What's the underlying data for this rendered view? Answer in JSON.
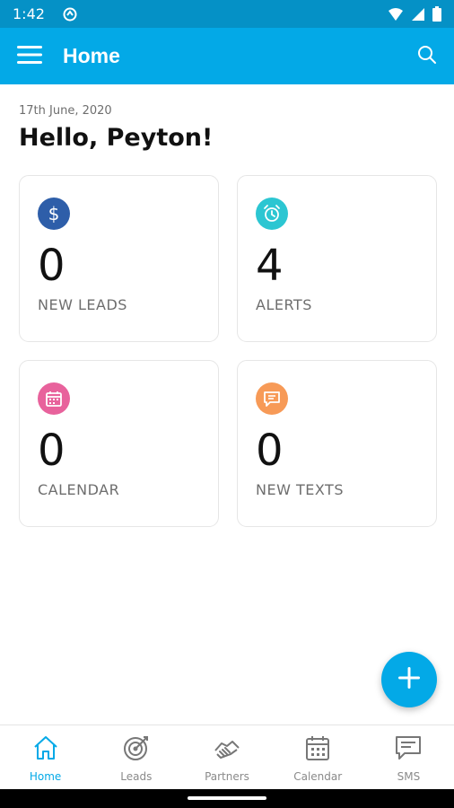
{
  "status_bar": {
    "time": "1:42",
    "bg_color": "#0591c6"
  },
  "app_bar": {
    "title": "Home",
    "bg_color": "#03a9e7",
    "icons": [
      "menu-icon",
      "search-icon"
    ]
  },
  "header": {
    "date": "17th June, 2020",
    "greeting": "Hello, Peyton!"
  },
  "cards": [
    {
      "count": "0",
      "label": "NEW LEADS",
      "icon": "dollar-icon",
      "color": "#2e5ea9"
    },
    {
      "count": "4",
      "label": "ALERTS",
      "icon": "alarm-clock-icon",
      "color": "#2cc6d2"
    },
    {
      "count": "0",
      "label": "CALENDAR",
      "icon": "calendar-icon",
      "color": "#e8629c"
    },
    {
      "count": "0",
      "label": "NEW TEXTS",
      "icon": "message-icon",
      "color": "#f79a57"
    }
  ],
  "fab": {
    "icon": "plus-icon",
    "color": "#03a9e7"
  },
  "bottom_nav": {
    "active": "Home",
    "items": [
      {
        "label": "Home",
        "icon": "home-icon"
      },
      {
        "label": "Leads",
        "icon": "target-icon"
      },
      {
        "label": "Partners",
        "icon": "handshake-icon"
      },
      {
        "label": "Calendar",
        "icon": "calendar-icon"
      },
      {
        "label": "SMS",
        "icon": "message-icon"
      }
    ]
  }
}
